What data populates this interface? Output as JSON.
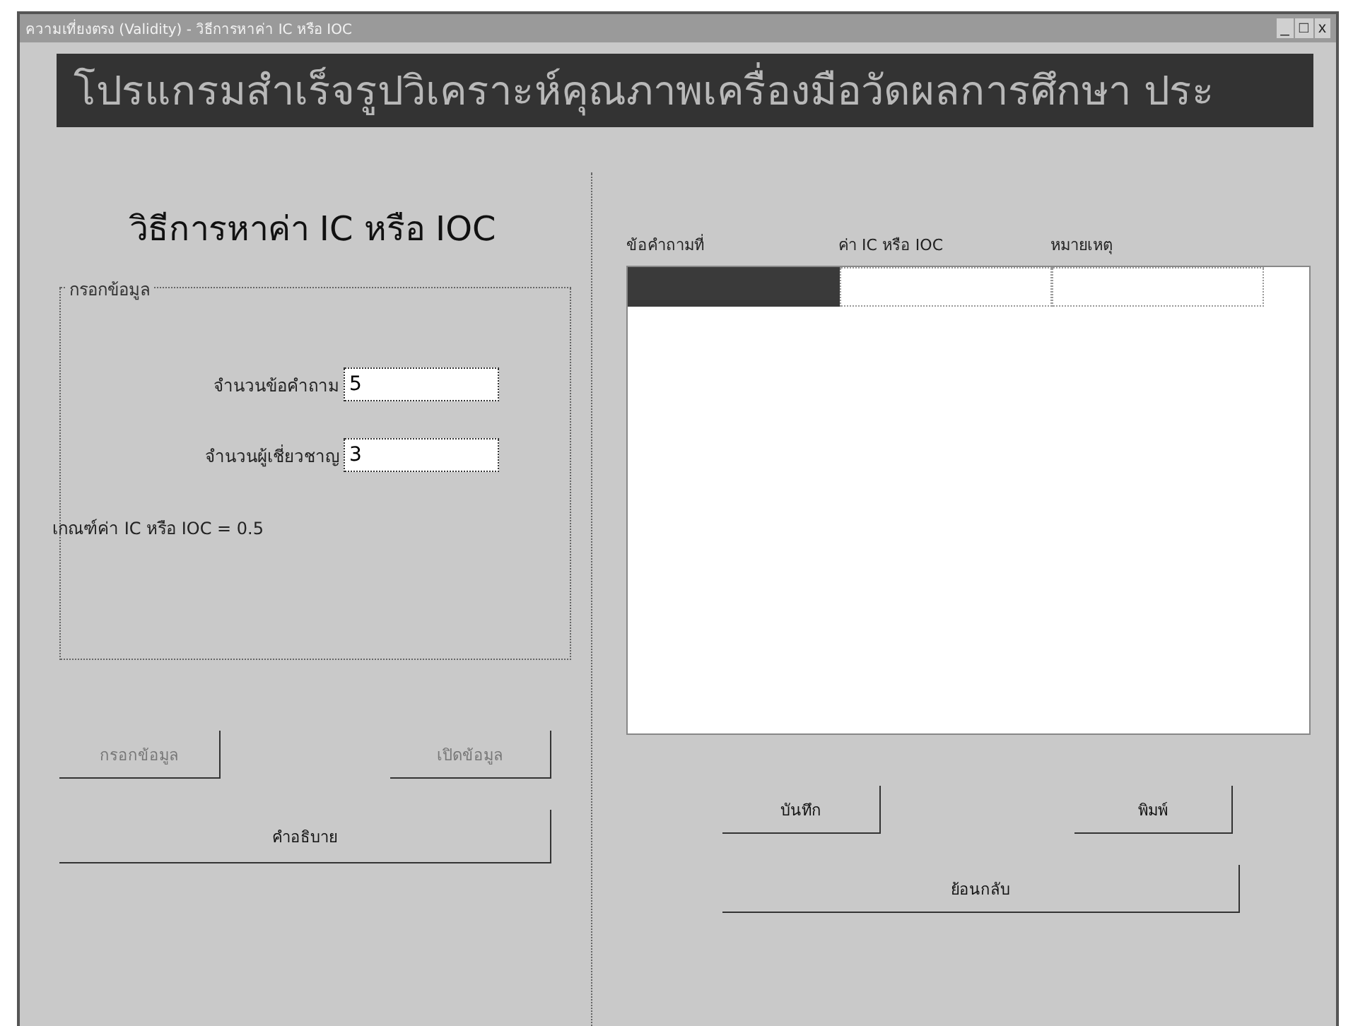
{
  "window": {
    "title": "ความเที่ยงตรง (Validity) - วิธีการหาค่า IC หรือ IOC",
    "controls": [
      "_",
      "□",
      "x"
    ]
  },
  "banner": "โปรแกรมสำเร็จรูปวิเคราะห์คุณภาพเครื่องมือวัดผลการศึกษา ประ",
  "left": {
    "heading": "วิธีการหาค่า IC หรือ IOC",
    "group": {
      "title": "กรอกข้อมูล",
      "fields": [
        {
          "label": "จำนวนข้อคำถาม",
          "value": "5"
        },
        {
          "label": "จำนวนผู้เชี่ยวชาญ",
          "value": "3"
        }
      ],
      "note": "เกณฑ์ค่า IC หรือ IOC = 0.5"
    },
    "buttons": [
      {
        "label": "กรอกข้อมูล",
        "disabled": true
      },
      {
        "label": "เปิดข้อมูล",
        "disabled": true
      }
    ],
    "wide_button": {
      "label": "คำอธิบาย",
      "disabled": false
    }
  },
  "right": {
    "table": {
      "columns": [
        "ข้อคำถามที่",
        "ค่า IC หรือ IOC",
        "หมายเหตุ"
      ]
    },
    "buttons": [
      {
        "label": "บันทึก",
        "disabled": false
      },
      {
        "label": "พิมพ์",
        "disabled": false
      }
    ],
    "wide_button": {
      "label": "ย้อนกลับ",
      "disabled": false
    }
  }
}
